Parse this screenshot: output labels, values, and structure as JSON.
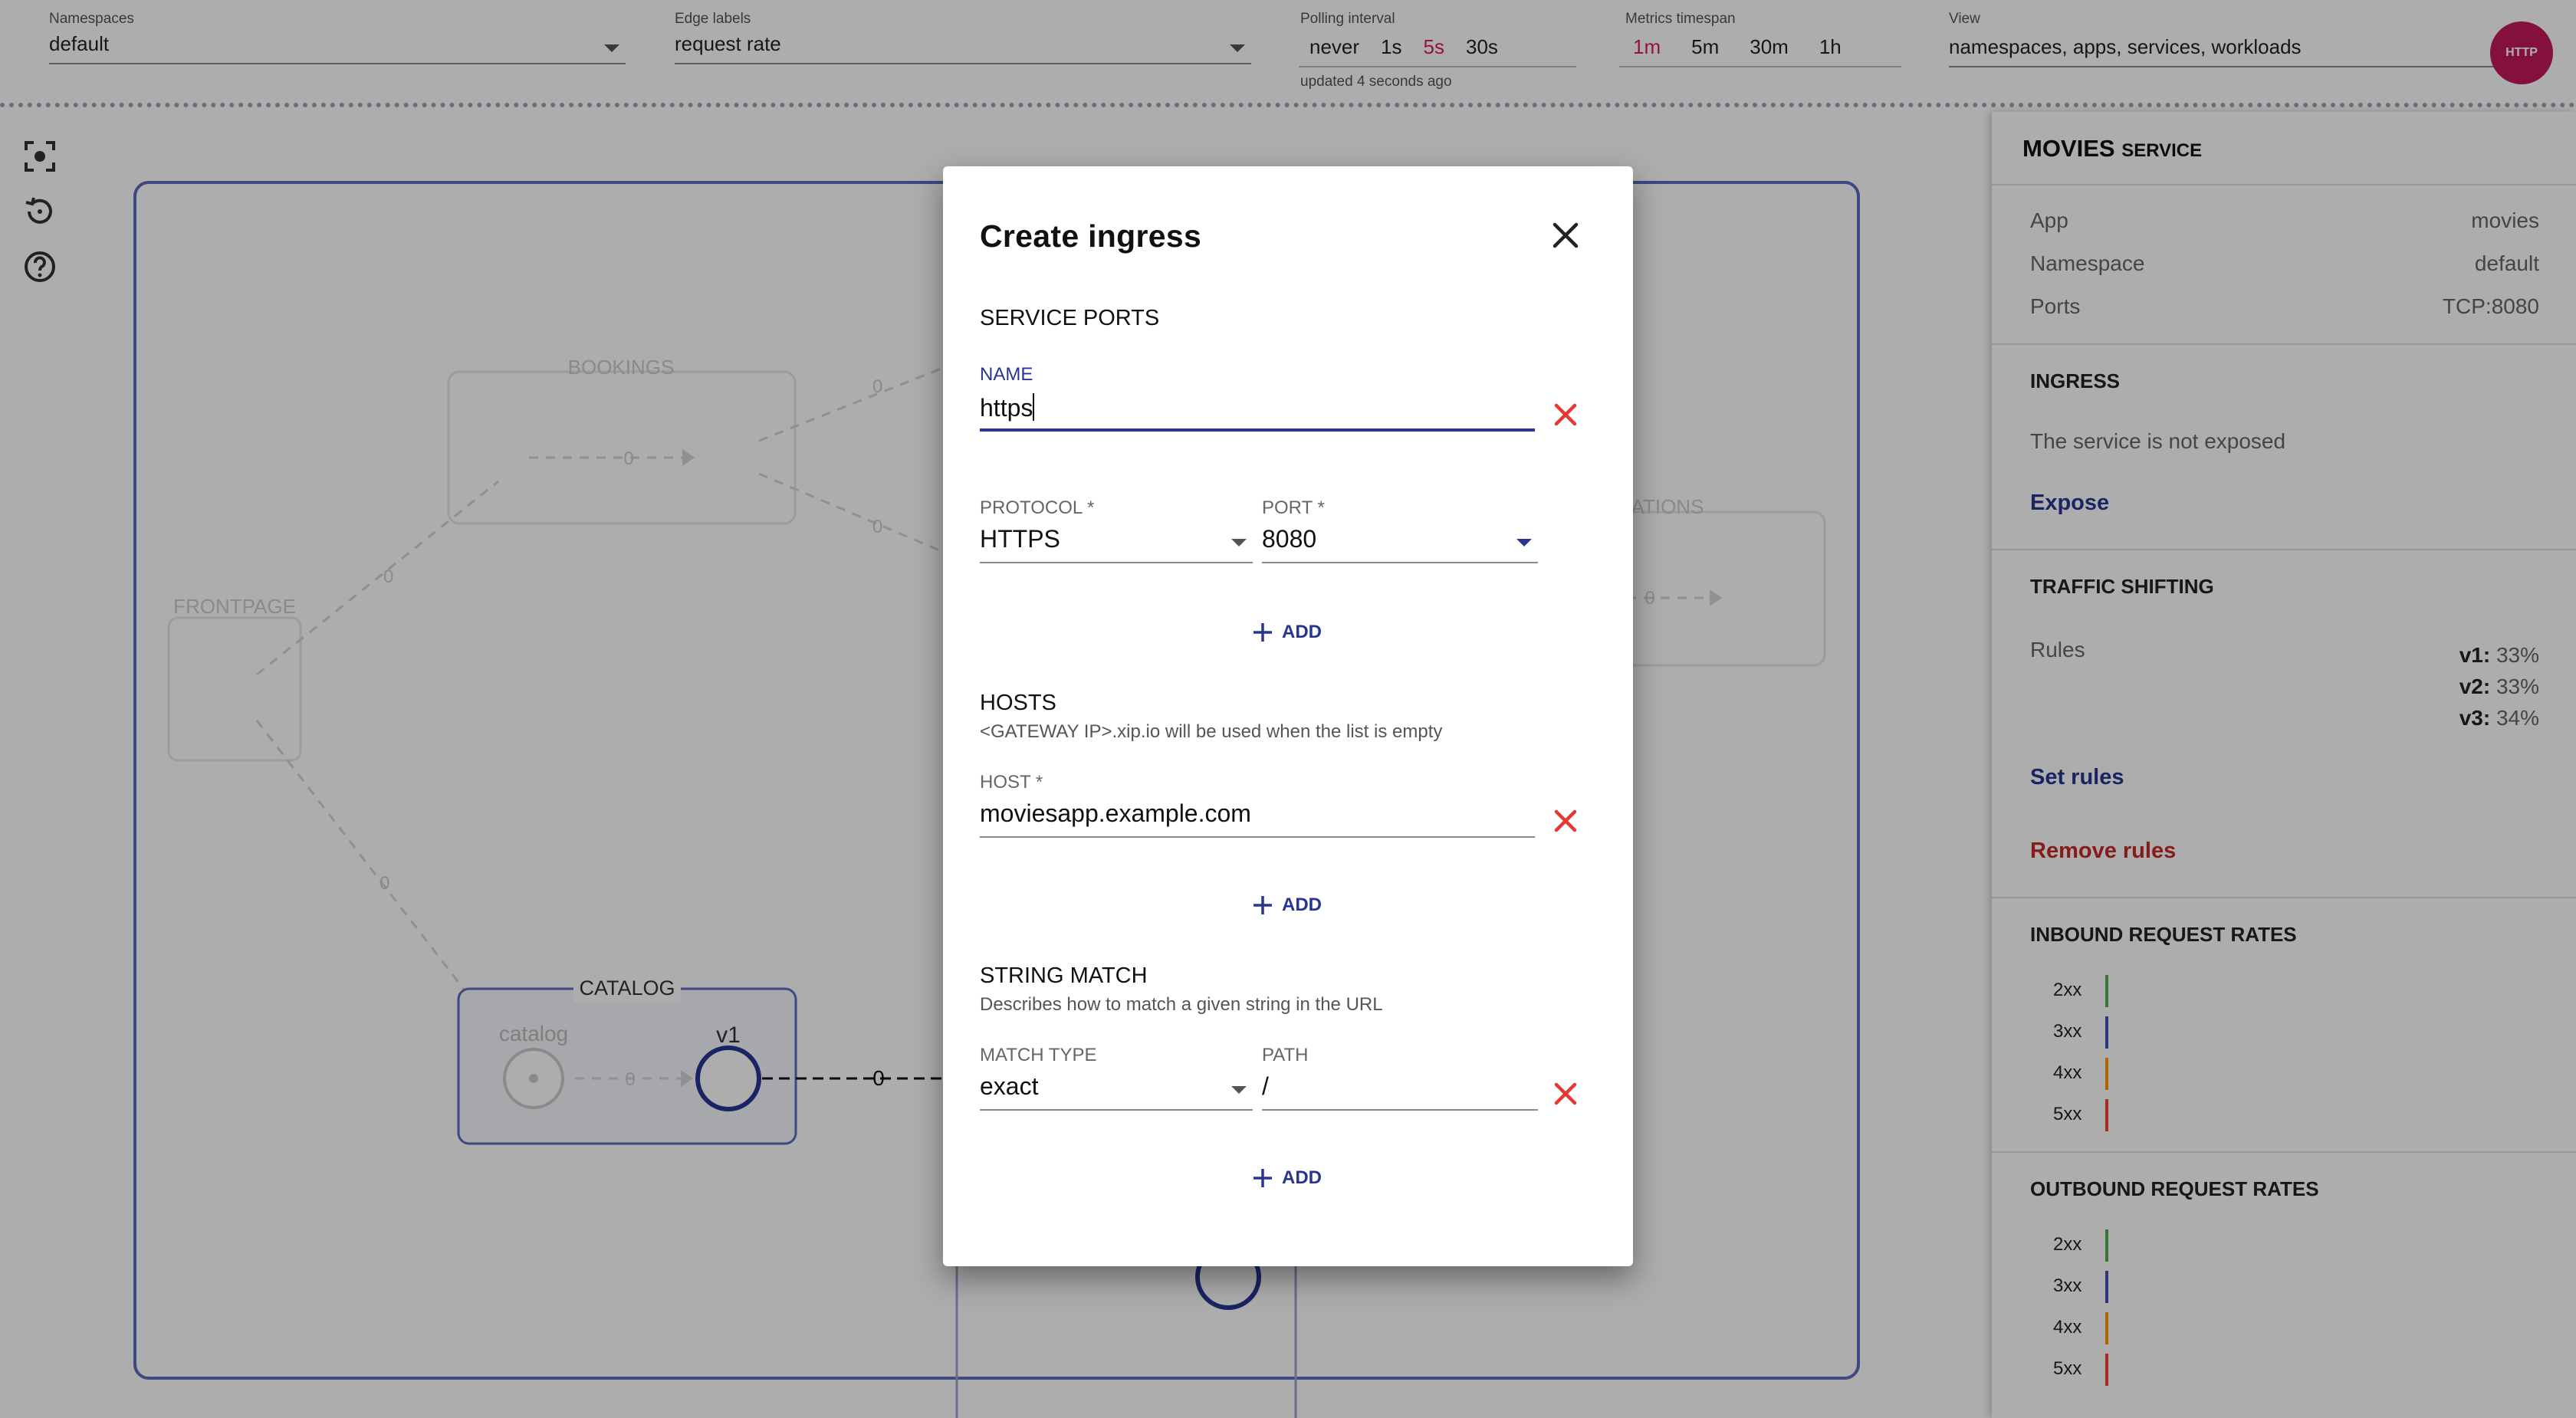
{
  "toolbar": {
    "namespaces": {
      "label": "Namespaces",
      "value": "default"
    },
    "edge_labels": {
      "label": "Edge labels",
      "value": "request rate"
    },
    "polling": {
      "label": "Polling interval",
      "options": [
        "never",
        "1s",
        "5s",
        "30s"
      ],
      "active": "5s",
      "updated": "updated 4 seconds ago"
    },
    "timespan": {
      "label": "Metrics timespan",
      "options": [
        "1m",
        "5m",
        "30m",
        "1h"
      ],
      "active": "1m"
    },
    "view": {
      "label": "View",
      "value": "namespaces, apps, services, workloads"
    },
    "badge": "HTTP"
  },
  "left_tools": [
    "fit-screen-icon",
    "history-icon",
    "help-icon"
  ],
  "graph": {
    "groups": [
      "BOOKINGS",
      "FRONTPAGE",
      "CATALOG",
      "ATIONS"
    ],
    "catalog_service": "catalog",
    "catalog_version": "v1",
    "edge_values": [
      "0",
      "0",
      "0",
      "0",
      "0",
      "0",
      "0",
      "0",
      "0"
    ]
  },
  "panel": {
    "title": "MOVIES",
    "title_suffix": "SERVICE",
    "details": [
      {
        "label": "App",
        "value": "movies"
      },
      {
        "label": "Namespace",
        "value": "default"
      },
      {
        "label": "Ports",
        "value": "TCP:8080"
      }
    ],
    "ingress": {
      "heading": "INGRESS",
      "text": "The service is not exposed",
      "link": "Expose"
    },
    "traffic": {
      "heading": "TRAFFIC SHIFTING",
      "rules_label": "Rules",
      "rules": [
        {
          "version": "v1:",
          "pct": "33%"
        },
        {
          "version": "v2:",
          "pct": "33%"
        },
        {
          "version": "v3:",
          "pct": "34%"
        }
      ],
      "set": "Set rules",
      "remove": "Remove rules"
    },
    "inbound": {
      "heading": "INBOUND REQUEST RATES",
      "codes": [
        "2xx",
        "3xx",
        "4xx",
        "5xx"
      ]
    },
    "outbound": {
      "heading": "OUTBOUND REQUEST RATES",
      "codes": [
        "2xx",
        "3xx",
        "4xx",
        "5xx"
      ]
    },
    "rate_colors": [
      "#4caf50",
      "#3f51b5",
      "#ff9800",
      "#f44336"
    ]
  },
  "dialog": {
    "title": "Create ingress",
    "service_ports": {
      "heading": "SERVICE PORTS",
      "name_label": "NAME",
      "name_value": "https",
      "protocol_label": "PROTOCOL *",
      "protocol_value": "HTTPS",
      "port_label": "PORT *",
      "port_value": "8080",
      "add": "ADD"
    },
    "hosts": {
      "heading": "HOSTS",
      "sub": "<GATEWAY IP>.xip.io will be used when the list is empty",
      "host_label": "HOST *",
      "host_value": "moviesapp.example.com",
      "add": "ADD"
    },
    "string_match": {
      "heading": "STRING MATCH",
      "sub": "Describes how to match a given string in the URL",
      "match_type_label": "MATCH TYPE",
      "match_type_value": "exact",
      "path_label": "PATH",
      "path_value": "/",
      "add": "ADD"
    }
  },
  "colors": {
    "accent": "#283593",
    "danger": "#e53935",
    "active": "#d81b60"
  }
}
